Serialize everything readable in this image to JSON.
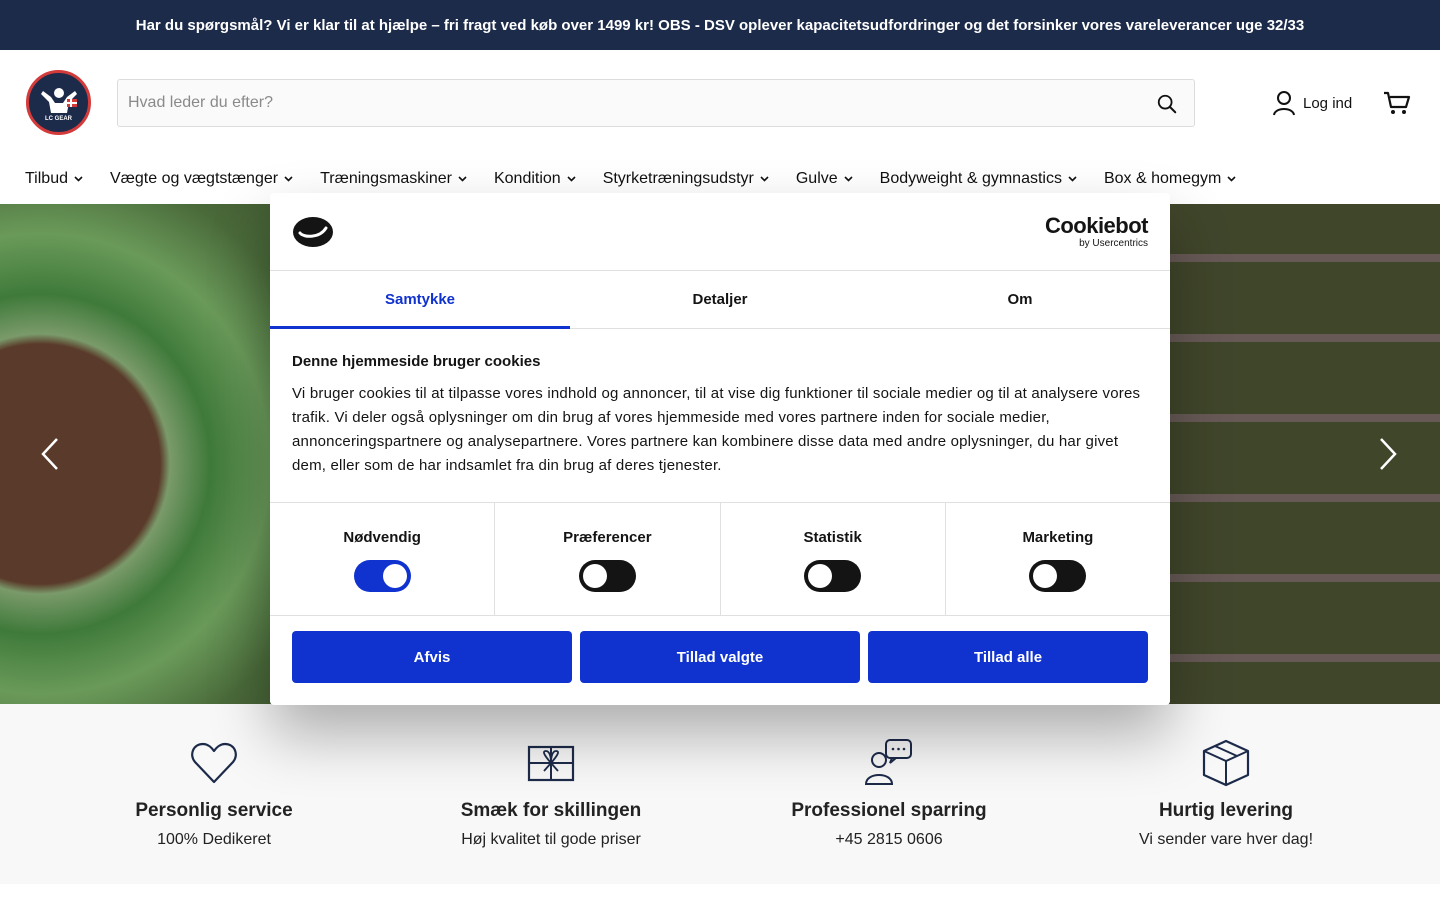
{
  "announcement": "Har du spørgsmål? Vi er klar til at hjælpe – fri fragt ved køb over 1499 kr! OBS - DSV oplever kapacitetsudfordringer og det forsinker vores vareleverancer uge 32/33",
  "logo": {
    "text": "LC GEAR"
  },
  "search": {
    "placeholder": "Hvad leder du efter?",
    "icon": "search-icon"
  },
  "account": {
    "login_label": "Log ind",
    "icon": "user-icon"
  },
  "cart": {
    "icon": "cart-icon"
  },
  "nav": [
    {
      "label": "Tilbud"
    },
    {
      "label": "Vægte og vægtstænger"
    },
    {
      "label": "Træningsmaskiner"
    },
    {
      "label": "Kondition"
    },
    {
      "label": "Styrketræningsudstyr"
    },
    {
      "label": "Gulve"
    },
    {
      "label": "Bodyweight & gymnastics"
    },
    {
      "label": "Box & homegym"
    }
  ],
  "hero": {
    "prev_icon": "chevron-left-icon",
    "next_icon": "chevron-right-icon"
  },
  "features": [
    {
      "icon": "heart-icon",
      "title": "Personlig service",
      "text": "100% Dedikeret"
    },
    {
      "icon": "gift-icon",
      "title": "Smæk for skillingen",
      "text": "Høj kvalitet til gode priser"
    },
    {
      "icon": "chat-person-icon",
      "title": "Professionel sparring",
      "text": "+45 2815 0606"
    },
    {
      "icon": "box-icon",
      "title": "Hurtig levering",
      "text": "Vi sender vare hver dag!"
    }
  ],
  "cookie": {
    "brand": "Cookiebot",
    "brand_sub": "by Usercentrics",
    "tabs": [
      {
        "label": "Samtykke",
        "active": true
      },
      {
        "label": "Detaljer",
        "active": false
      },
      {
        "label": "Om",
        "active": false
      }
    ],
    "heading": "Denne hjemmeside bruger cookies",
    "body": "Vi bruger cookies til at tilpasse vores indhold og annoncer, til at vise dig funktioner til sociale medier og til at analysere vores trafik. Vi deler også oplysninger om din brug af vores hjemmeside med vores partnere inden for sociale medier, annonceringspartnere og analysepartnere. Vores partnere kan kombinere disse data med andre oplysninger, du har givet dem, eller som de har indsamlet fra din brug af deres tjenester.",
    "toggles": [
      {
        "label": "Nødvendig",
        "on": true
      },
      {
        "label": "Præferencer",
        "on": false
      },
      {
        "label": "Statistik",
        "on": false
      },
      {
        "label": "Marketing",
        "on": false
      }
    ],
    "buttons": {
      "deny": "Afvis",
      "allow_selected": "Tillad valgte",
      "allow_all": "Tillad alle"
    }
  },
  "colors": {
    "navy": "#1d2b4a",
    "cookie_blue": "#1032cf",
    "features_bg": "#f8f8f8"
  }
}
